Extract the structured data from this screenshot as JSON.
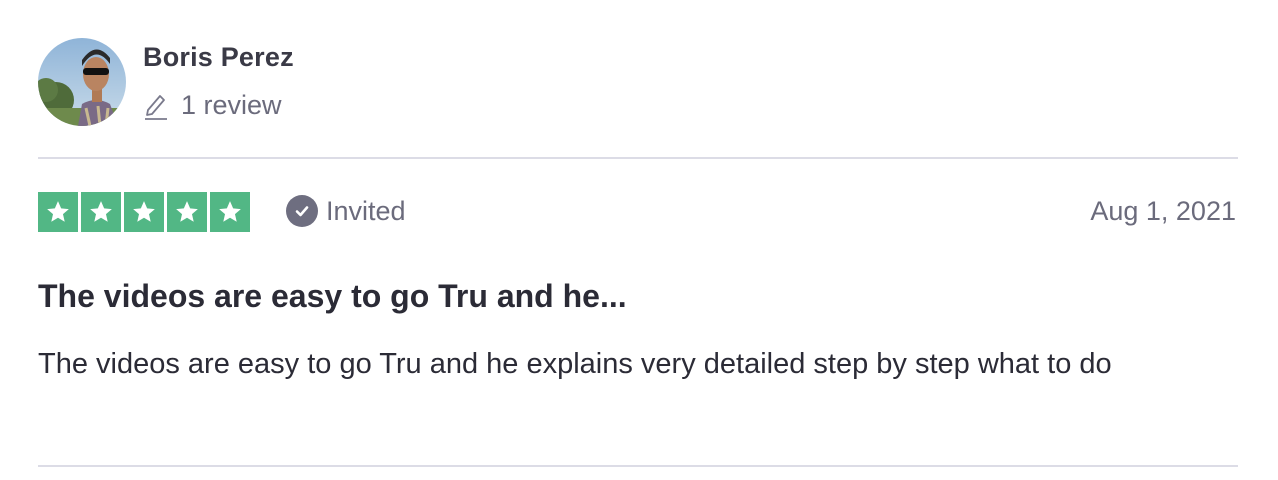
{
  "reviewer": {
    "name": "Boris Perez",
    "review_count": "1 review"
  },
  "review": {
    "rating": 5,
    "rating_max": 5,
    "star_color": "#52b785",
    "status": "Invited",
    "date": "Aug 1, 2021",
    "title": "The videos are easy to go Tru and he...",
    "body": "The videos are easy to go Tru and he explains very detailed step by step what to do"
  },
  "icons": {
    "pen": "pen-icon",
    "check": "check-circle-icon",
    "star": "star-icon"
  }
}
